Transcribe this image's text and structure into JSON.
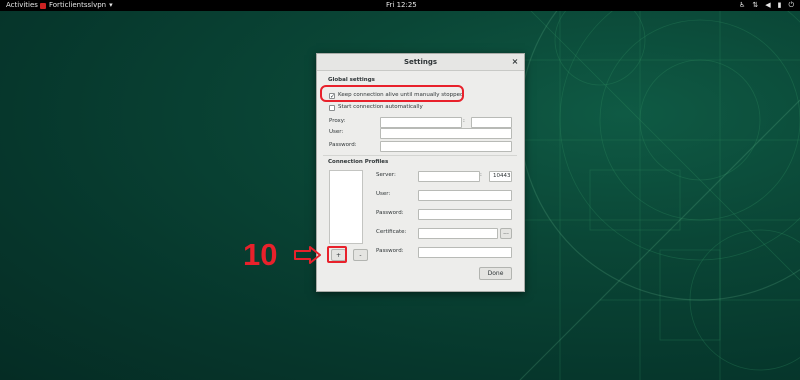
{
  "topbar": {
    "activities": "Activities",
    "app_name": "Forticlientsslvpn",
    "app_menu_arrow": "▾",
    "clock": "Fri 12:25",
    "tray_icons": [
      "accessibility-icon",
      "network-icon",
      "volume-icon",
      "battery-icon",
      "power-icon"
    ]
  },
  "dialog": {
    "title": "Settings",
    "close": "×",
    "global": {
      "title": "Global settings",
      "keep_alive": {
        "label": "Keep connection alive until manually stopped",
        "checked": true
      },
      "auto_start": {
        "label": "Start connection automatically",
        "checked": false
      },
      "proxy_label": "Proxy:",
      "proxy_separator": ":",
      "proxy_host": "",
      "proxy_port": "",
      "user_label": "User:",
      "user_value": "",
      "password_label": "Password:",
      "password_value": ""
    },
    "profiles": {
      "title": "Connection Profiles",
      "items": [],
      "server_label": "Server:",
      "server_separator": ":",
      "server_value": "",
      "port_value": "10443",
      "user_label": "User:",
      "password_label": "Password:",
      "certificate_label": "Certificate:",
      "browse_label": "...",
      "cert_password_label": "Password:",
      "add_label": "+",
      "remove_label": "-"
    },
    "done_label": "Done"
  },
  "annotation": {
    "step_number": "10",
    "color": "#e8212b"
  }
}
